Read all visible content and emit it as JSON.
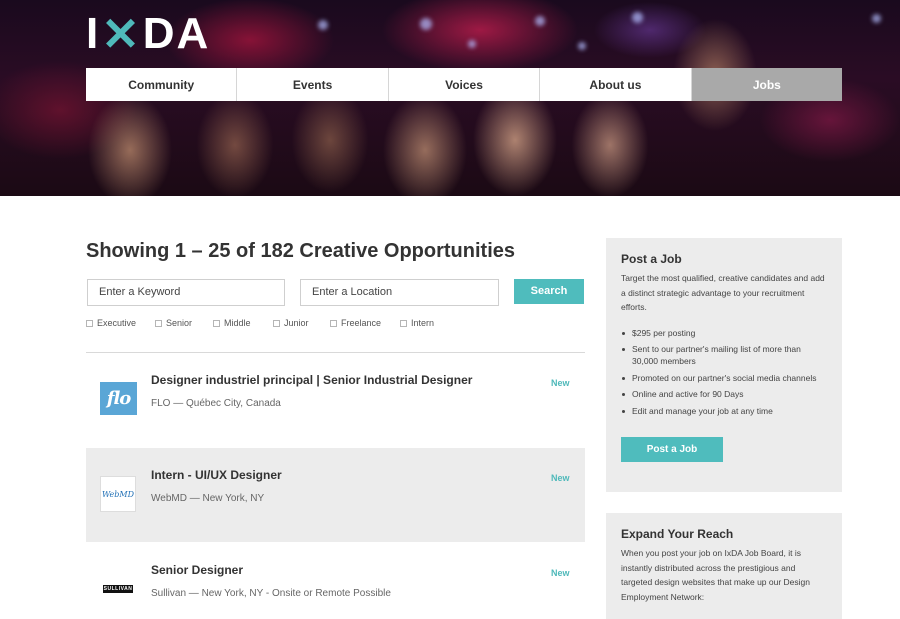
{
  "brand": {
    "logo_text": "IxDA",
    "accent": "#4fb9ba"
  },
  "nav": {
    "items": [
      {
        "label": "Community",
        "active": false
      },
      {
        "label": "Events",
        "active": false
      },
      {
        "label": "Voices",
        "active": false
      },
      {
        "label": "About us",
        "active": false
      },
      {
        "label": "Jobs",
        "active": true
      }
    ]
  },
  "search": {
    "heading": "Showing 1 – 25 of 182 Creative Opportunities",
    "keyword_placeholder": "Enter a Keyword",
    "location_placeholder": "Enter a Location",
    "button_label": "Search",
    "filters": [
      "Executive",
      "Senior",
      "Middle",
      "Junior",
      "Freelance",
      "Intern"
    ]
  },
  "jobs": [
    {
      "logo": "flo",
      "title": "Designer industriel principal | Senior Industrial Designer",
      "meta": "FLO — Québec City, Canada",
      "badge": "New"
    },
    {
      "logo": "WebMD",
      "title": "Intern - UI/UX Designer",
      "meta": "WebMD — New York, NY",
      "badge": "New"
    },
    {
      "logo": "SULLIVAN",
      "title": "Senior Designer",
      "meta": "Sullivan — New York, NY - Onsite or Remote Possible",
      "badge": "New"
    }
  ],
  "sidebar": {
    "post": {
      "title": "Post a Job",
      "description": "Target the most qualified, creative candidates and add a distinct strategic advantage to your recruitment efforts.",
      "bullets": [
        "$295 per posting",
        "Sent to our partner's mailing list of more than 30,000 members",
        "Promoted on our partner's social media channels",
        "Online and active for 90 Days",
        "Edit and manage your job at any time"
      ],
      "button_label": "Post a Job"
    },
    "reach": {
      "title": "Expand Your Reach",
      "description": "When you post your job on IxDA Job Board, it is instantly distributed across the prestigious and targeted design websites that make up our Design Employment Network:"
    }
  }
}
